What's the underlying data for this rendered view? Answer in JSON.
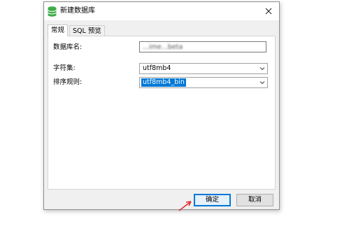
{
  "window": {
    "title": "新建数据库",
    "icon": "database-icon",
    "close_icon": "close-icon"
  },
  "tabs": [
    {
      "label": "常规",
      "active": true
    },
    {
      "label": "SQL 预览",
      "active": false
    }
  ],
  "form": {
    "db_name_label": "数据库名:",
    "db_name_value": "...ime...beta",
    "charset_label": "字符集:",
    "charset_value": "utf8mb4",
    "collation_label": "排序规则:",
    "collation_value": "utf8mb4_bin"
  },
  "buttons": {
    "ok_label": "确定",
    "cancel_label": "取消"
  },
  "colors": {
    "accent": "#0078d7",
    "icon_green": "#3fae49",
    "annotation_arrow": "#e03030"
  }
}
